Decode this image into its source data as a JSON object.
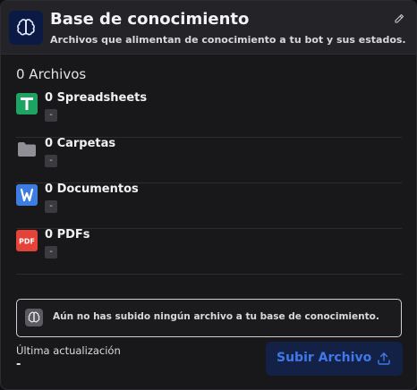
{
  "header": {
    "title": "Base de conocimiento",
    "subtitle": "Archivos que alimentan de conocimiento a tu bot y sus estados.",
    "brain_icon": "brain-icon",
    "edit_icon": "pencil-icon"
  },
  "files": {
    "section_title": "0 Archivos",
    "items": [
      {
        "label": "0 Spreadsheets",
        "sub": "-",
        "icon": "google-sheets-icon"
      },
      {
        "label": "0 Carpetas",
        "sub": "-",
        "icon": "folder-icon"
      },
      {
        "label": "0 Documentos",
        "sub": "-",
        "icon": "word-document-icon"
      },
      {
        "label": "0 PDFs",
        "sub": "-",
        "icon": "pdf-icon"
      }
    ]
  },
  "notice": {
    "text": "Aún no has subido ningún archivo a tu base de conocimiento.",
    "icon": "brain-icon"
  },
  "footer": {
    "updated_label": "Última actualización",
    "updated_value": "-",
    "upload_label": "Subir Archivo",
    "upload_icon": "upload-icon"
  },
  "colors": {
    "accent": "#3f78ea",
    "sheets": "#1ea362",
    "word": "#3d7ce0",
    "pdf": "#e4433a"
  }
}
